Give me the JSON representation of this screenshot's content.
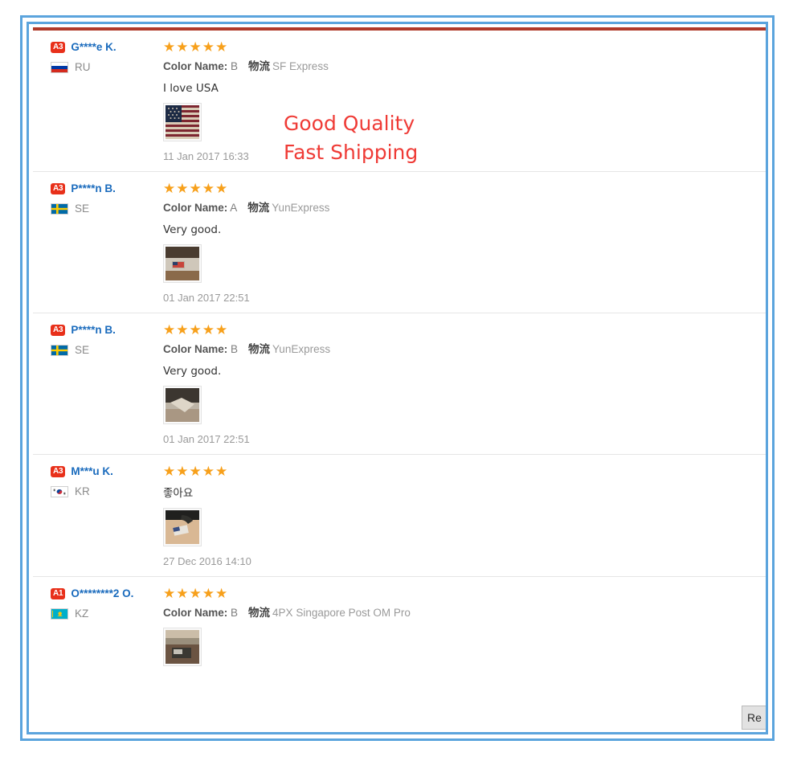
{
  "panel": {
    "accent_top_color": "#b03a2a",
    "frame_color": "#5ba4dd",
    "star_color": "#f7a01b",
    "badge_color": "#e8301a",
    "name_color": "#1a6bbd"
  },
  "annotation": {
    "text": "Good Quality\nFast Shipping",
    "color": "#ef3b36"
  },
  "corner_button": {
    "label": "Re"
  },
  "labels": {
    "color_name": "Color Name:",
    "logistics": "物流"
  },
  "reviews": [
    {
      "level": "A3",
      "name": "G****e K.",
      "country_code": "RU",
      "flag": "ru",
      "stars": "★★★★★",
      "rating": 5,
      "color_name": "B",
      "logistics": "SF Express",
      "comment": "I love USA",
      "has_photo": true,
      "photo": "us-flag-vintage",
      "timestamp": "11 Jan 2017 16:33"
    },
    {
      "level": "A3",
      "name": "P****n B.",
      "country_code": "SE",
      "flag": "se",
      "stars": "★★★★★",
      "rating": 5,
      "color_name": "A",
      "logistics": "YunExpress",
      "comment": "Very good.",
      "has_photo": true,
      "photo": "product-photo-1",
      "timestamp": "01 Jan 2017 22:51"
    },
    {
      "level": "A3",
      "name": "P****n B.",
      "country_code": "SE",
      "flag": "se",
      "stars": "★★★★★",
      "rating": 5,
      "color_name": "B",
      "logistics": "YunExpress",
      "comment": "Very good.",
      "has_photo": true,
      "photo": "product-photo-2",
      "timestamp": "01 Jan 2017 22:51"
    },
    {
      "level": "A3",
      "name": "M***u K.",
      "country_code": "KR",
      "flag": "kr",
      "stars": "★★★★★",
      "rating": 5,
      "color_name": null,
      "logistics": null,
      "comment": "좋아요",
      "has_photo": true,
      "photo": "product-photo-3",
      "timestamp": "27 Dec 2016 14:10"
    },
    {
      "level": "A1",
      "name": "O********2 O.",
      "country_code": "KZ",
      "flag": "kz",
      "stars": "★★★★★",
      "rating": 5,
      "color_name": "B",
      "logistics": "4PX Singapore Post OM Pro",
      "comment": null,
      "has_photo": true,
      "photo": "product-photo-4",
      "timestamp": null
    }
  ]
}
